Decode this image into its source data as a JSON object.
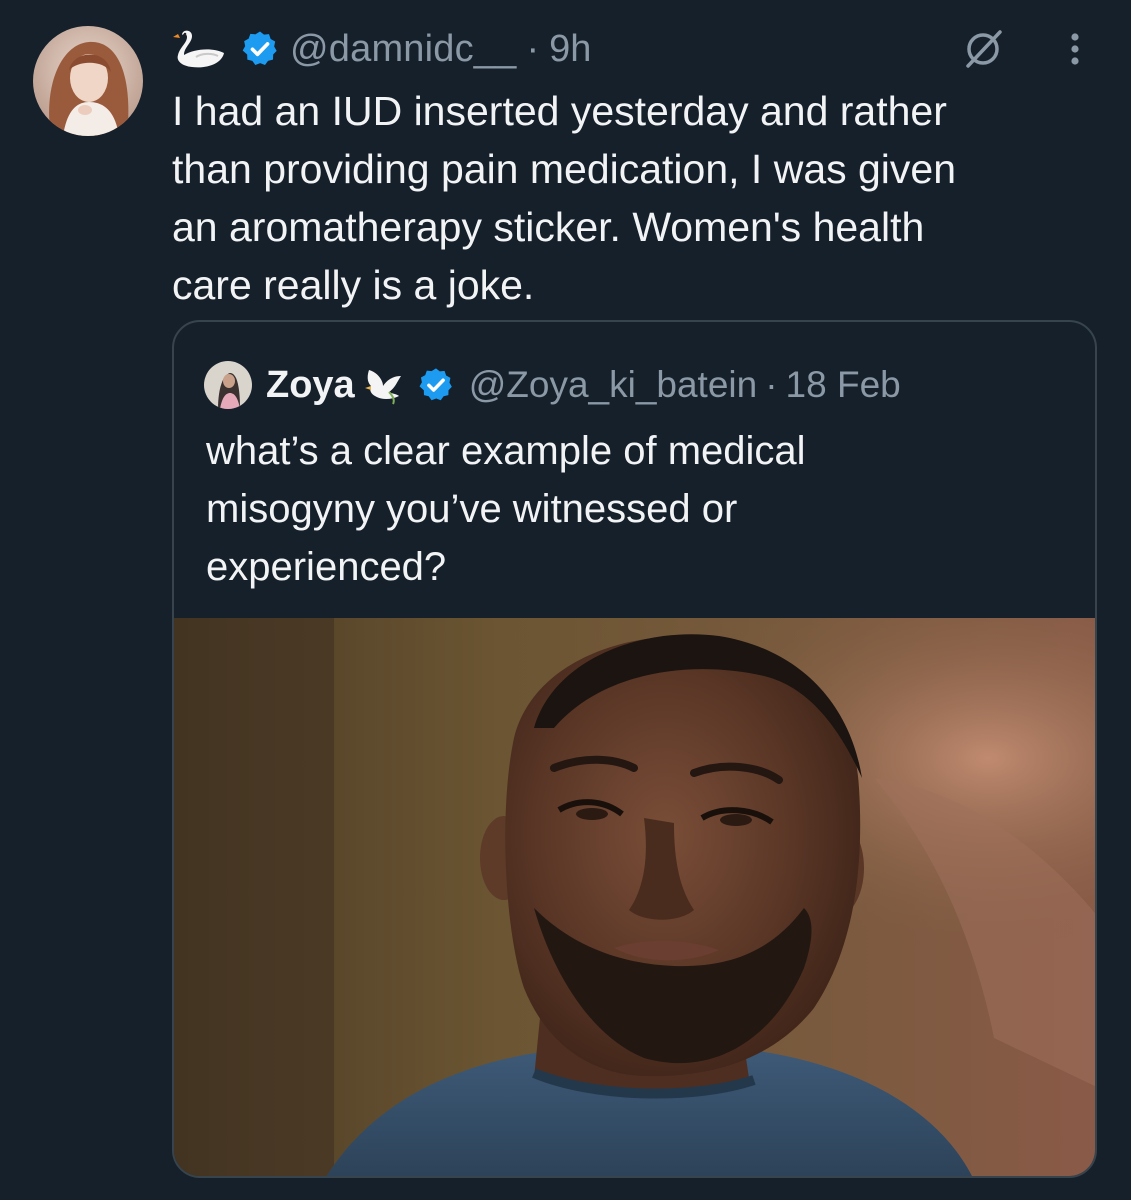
{
  "tweet": {
    "handle": "@damnidc__",
    "separator": "·",
    "time": "9h",
    "text_lines": [
      "I had an IUD inserted yesterday and rather",
      "than providing pain medication, I was given",
      "an aromatherapy sticker. Women's health",
      "care really is a joke."
    ],
    "icons": {
      "name_emoji": "swan-icon",
      "verified": "verified-badge-icon",
      "grok": "grok-icon",
      "more": "more-options-icon"
    }
  },
  "quoted_tweet": {
    "display_name": "Zoya",
    "handle": "@Zoya_ki_batein",
    "separator": "·",
    "date": "18 Feb",
    "text_lines": [
      "what’s a clear example of medical",
      "misogyny you’ve witnessed or",
      "experienced?"
    ],
    "icons": {
      "name_emoji": "dove-icon",
      "verified": "verified-badge-icon"
    },
    "media": "photo of a tearful man in a blue t-shirt"
  },
  "colors": {
    "background": "#15202b",
    "text": "#e7e9ea",
    "secondary_text": "#8b98a5",
    "border": "#38444d",
    "verified": "#1d9bf0"
  }
}
